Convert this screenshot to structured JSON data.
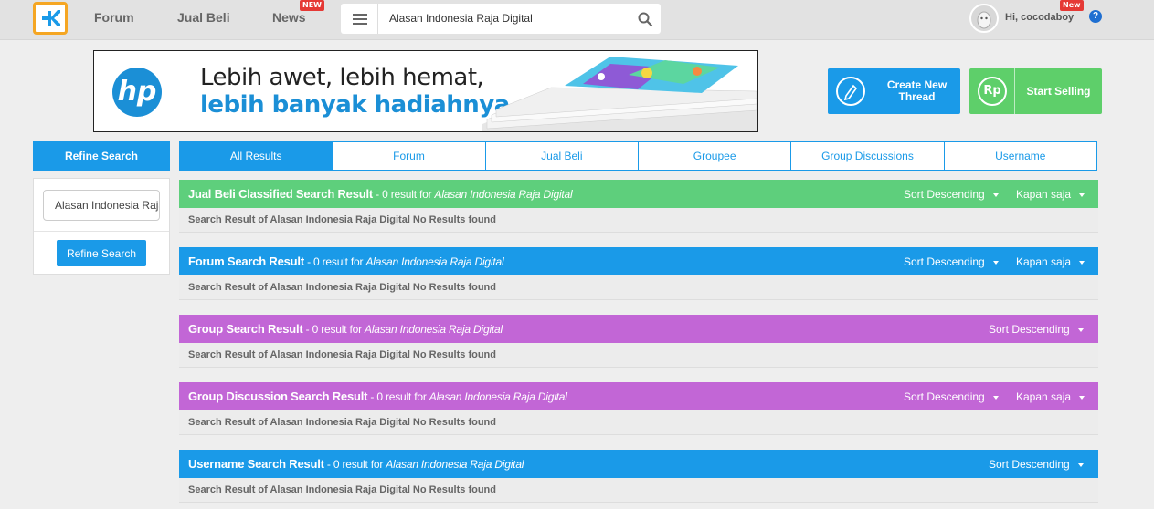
{
  "nav": {
    "forum": "Forum",
    "jual_beli": "Jual Beli",
    "news": "News",
    "news_badge": "NEW",
    "search_value": "Alasan Indonesia Raja Digital",
    "user_greeting": "Hi, cocodaboy",
    "user_badge": "New",
    "help": "?"
  },
  "banner": {
    "brand": "hp",
    "line1": "Lebih awet, lebih hemat,",
    "line2": "lebih banyak hadiahnya"
  },
  "actions": {
    "create_thread": "Create New Thread",
    "start_selling": "Start Selling",
    "currency_icon_text": "Rp"
  },
  "sidebar": {
    "heading": "Refine Search",
    "input_value": "Alasan Indonesia Raja Digital",
    "button": "Refine Search"
  },
  "tabs": [
    "All Results",
    "Forum",
    "Jual Beli",
    "Groupee",
    "Group Discussions",
    "Username"
  ],
  "query": "Alasan Indonesia Raja Digital",
  "results": [
    {
      "title": "Jual Beli Classified Search Result",
      "count": " - 0 result for ",
      "sort": "Sort Descending",
      "time": "Kapan saja",
      "body": "Search Result of Alasan Indonesia Raja Digital No Results found",
      "color": "#5ecf7c"
    },
    {
      "title": "Forum Search Result",
      "count": " - 0 result for ",
      "sort": "Sort Descending",
      "time": "Kapan saja",
      "body": "Search Result of Alasan Indonesia Raja Digital No Results found",
      "color": "#1a9ae8"
    },
    {
      "title": "Group Search Result",
      "count": " - 0 result for ",
      "sort": "Sort Descending",
      "body": "Search Result of Alasan Indonesia Raja Digital No Results found",
      "color": "#c266d6"
    },
    {
      "title": "Group Discussion Search Result",
      "count": " - 0 result for ",
      "sort": "Sort Descending",
      "time": "Kapan saja",
      "body": "Search Result of Alasan Indonesia Raja Digital No Results found",
      "color": "#c266d6"
    },
    {
      "title": "Username Search Result",
      "count": " - 0 result for ",
      "sort": "Sort Descending",
      "body": "Search Result of Alasan Indonesia Raja Digital No Results found",
      "color": "#1a9ae8"
    }
  ],
  "colors": {
    "accent": "#1a9ae8",
    "green": "#5ecf7c",
    "purple": "#c266d6",
    "logo_border": "#f5a623"
  }
}
